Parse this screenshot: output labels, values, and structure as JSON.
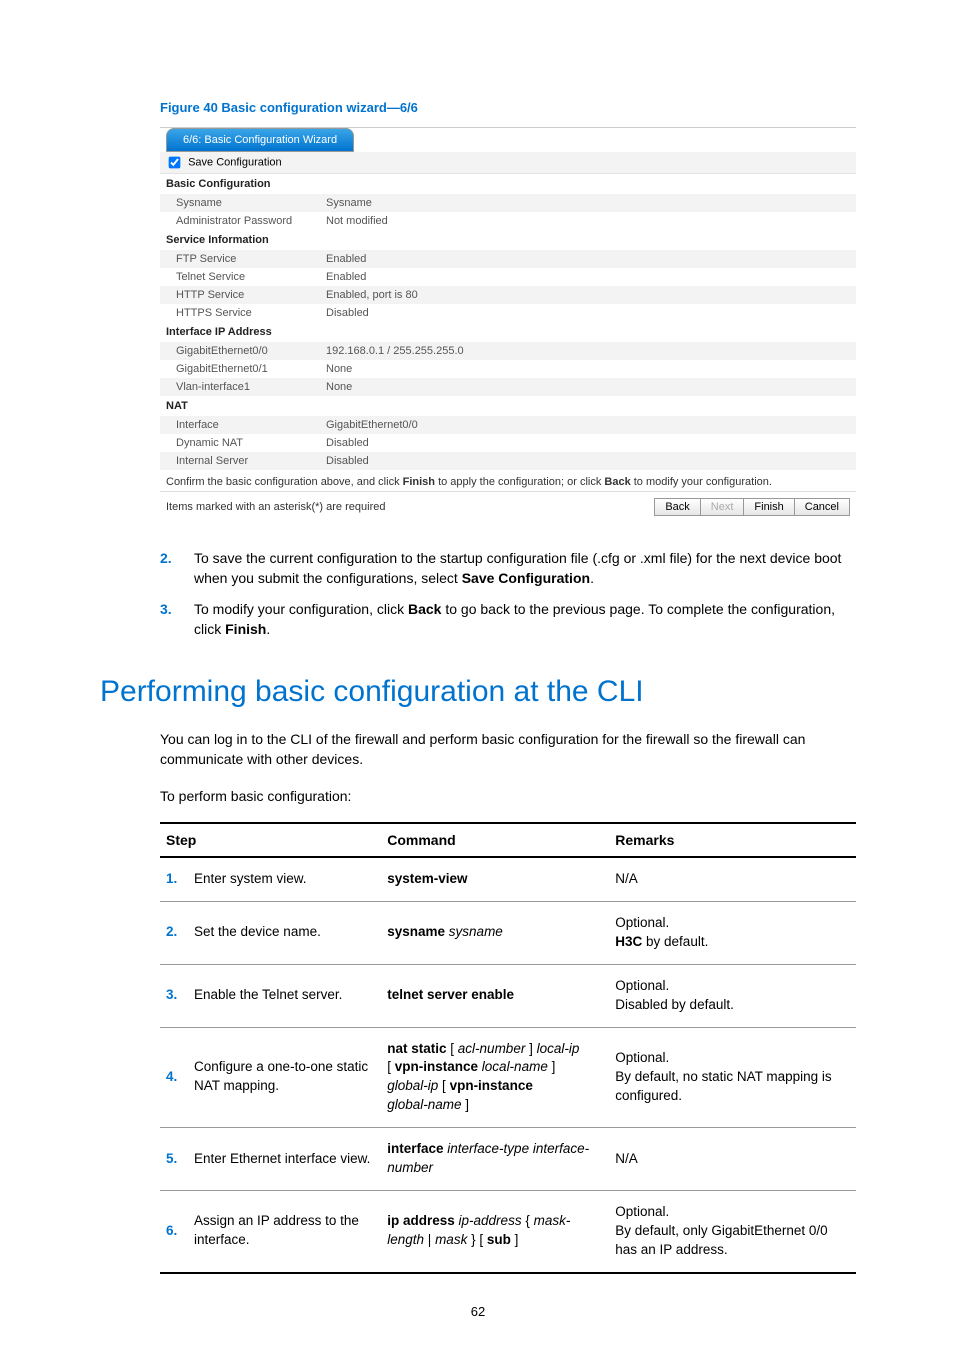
{
  "figure_caption": "Figure 40 Basic configuration wizard—6/6",
  "wizard": {
    "tab_title": "6/6: Basic Configuration Wizard",
    "save_label": "Save Configuration",
    "sections": {
      "basic": {
        "title": "Basic Configuration",
        "rows": [
          {
            "k": "Sysname",
            "v": "Sysname"
          },
          {
            "k": "Administrator Password",
            "v": "Not modified"
          }
        ]
      },
      "service": {
        "title": "Service Information",
        "rows": [
          {
            "k": "FTP Service",
            "v": "Enabled"
          },
          {
            "k": "Telnet Service",
            "v": "Enabled"
          },
          {
            "k": "HTTP Service",
            "v": "Enabled, port is 80"
          },
          {
            "k": "HTTPS Service",
            "v": "Disabled"
          }
        ]
      },
      "iface": {
        "title": "Interface IP Address",
        "rows": [
          {
            "k": "GigabitEthernet0/0",
            "v": "192.168.0.1 / 255.255.255.0"
          },
          {
            "k": "GigabitEthernet0/1",
            "v": "None"
          },
          {
            "k": "Vlan-interface1",
            "v": "None"
          }
        ]
      },
      "nat": {
        "title": "NAT",
        "rows": [
          {
            "k": "Interface",
            "v": "GigabitEthernet0/0"
          },
          {
            "k": "Dynamic NAT",
            "v": "Disabled"
          },
          {
            "k": "Internal Server",
            "v": "Disabled"
          }
        ]
      }
    },
    "confirm_pre": "Confirm the basic configuration above, and click ",
    "confirm_b1": "Finish",
    "confirm_mid": " to apply the configuration; or click ",
    "confirm_b2": "Back",
    "confirm_post": " to modify your configuration.",
    "asterisk_note": "Items marked with an asterisk(*) are required",
    "buttons": {
      "back": "Back",
      "next": "Next",
      "finish": "Finish",
      "cancel": "Cancel"
    }
  },
  "list": {
    "i2": {
      "num": "2.",
      "pre": "To save the current configuration to the startup configuration file (.cfg or .xml file) for the next device boot when you submit the configurations, select ",
      "b": "Save Configuration",
      "post": "."
    },
    "i3": {
      "num": "3.",
      "pre": "To modify your configuration, click ",
      "b1": "Back",
      "mid": " to go back to the previous page. To complete the configuration, click ",
      "b2": "Finish",
      "post": "."
    }
  },
  "h1": "Performing basic configuration at the CLI",
  "p1": "You can log in to the CLI of the firewall and perform basic configuration for the firewall so the firewall can communicate with other devices.",
  "p2": "To perform basic configuration:",
  "table": {
    "headers": {
      "step": "Step",
      "command": "Command",
      "remarks": "Remarks"
    },
    "rows": {
      "r1": {
        "n": "1.",
        "step": "Enter system view.",
        "cmd_b": "system-view",
        "remarks": "N/A"
      },
      "r2": {
        "n": "2.",
        "step": "Set the device name.",
        "cmd_b": "sysname",
        "cmd_i": " sysname",
        "rem_l1": "Optional.",
        "rem_b": "H3C",
        "rem_l2": " by default."
      },
      "r3": {
        "n": "3.",
        "step": "Enable the Telnet server.",
        "cmd_b": "telnet server enable",
        "rem_l1": "Optional.",
        "rem_l2": "Disabled by default."
      },
      "r4": {
        "n": "4.",
        "step": "Configure a one-to-one static NAT mapping.",
        "c_b1": "nat static",
        "c_t1": " [ ",
        "c_i1": "acl-number",
        "c_t2": " ] ",
        "c_i2": "local-ip",
        "c_t3": " [ ",
        "c_b2": "vpn-instance",
        "c_i3": " local-name",
        "c_t4": " ] ",
        "c_i4": "global-ip",
        "c_t5": " [ ",
        "c_b3": "vpn-instance",
        "c_i5": " global-name",
        "c_t6": " ]",
        "rem_l1": "Optional.",
        "rem_l2": "By default, no static NAT mapping is configured."
      },
      "r5": {
        "n": "5.",
        "step": "Enter Ethernet interface view.",
        "c_b1": "interface",
        "c_i1": " interface-type interface-number",
        "remarks": "N/A"
      },
      "r6": {
        "n": "6.",
        "step": "Assign an IP address to the interface.",
        "c_b1": "ip address",
        "c_i1": " ip-address",
        "c_t1": " { ",
        "c_i2": "mask-length",
        "c_t2": " | ",
        "c_i3": "mask",
        "c_t3": " } [ ",
        "c_b2": "sub",
        "c_t4": " ]",
        "rem_l1": "Optional.",
        "rem_l2": "By default, only GigabitEthernet 0/0 has an IP address."
      }
    }
  },
  "page_number": "62"
}
